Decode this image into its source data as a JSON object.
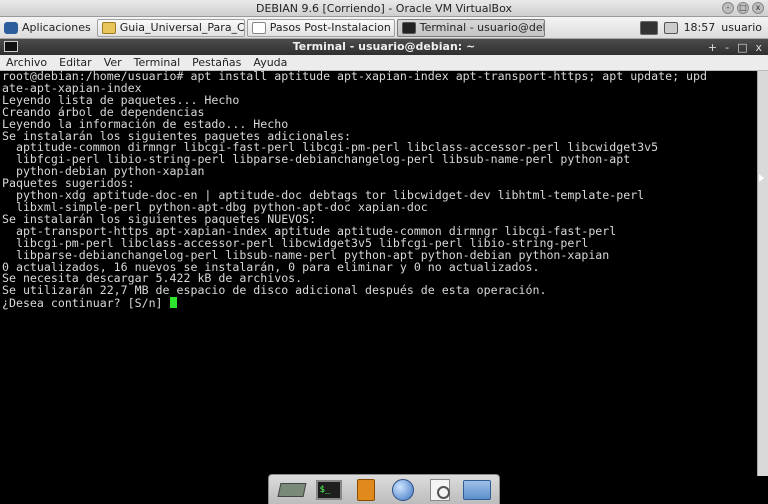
{
  "vbox": {
    "title": "DEBIAN 9.6 [Corriendo] - Oracle VM VirtualBox",
    "controls": [
      "-",
      "□",
      "x"
    ]
  },
  "panel": {
    "apps_label": "Aplicaciones",
    "tasks": [
      {
        "label": "Guia_Universal_Para_Co..."
      },
      {
        "label": "Pasos Post-Instalacion D..."
      },
      {
        "label": "Terminal - usuario@debi..."
      }
    ],
    "clock": "18:57",
    "user": "usuario"
  },
  "terminal": {
    "title": "Terminal - usuario@debian: ~",
    "controls": [
      "+",
      "-",
      "□",
      "x"
    ],
    "menu": [
      "Archivo",
      "Editar",
      "Ver",
      "Terminal",
      "Pestañas",
      "Ayuda"
    ],
    "lines": [
      "root@debian:/home/usuario# apt install aptitude apt-xapian-index apt-transport-https; apt update; upd",
      "ate-apt-xapian-index",
      "Leyendo lista de paquetes... Hecho",
      "Creando árbol de dependencias",
      "Leyendo la información de estado... Hecho",
      "Se instalarán los siguientes paquetes adicionales:",
      "  aptitude-common dirmngr libcgi-fast-perl libcgi-pm-perl libclass-accessor-perl libcwidget3v5",
      "  libfcgi-perl libio-string-perl libparse-debianchangelog-perl libsub-name-perl python-apt",
      "  python-debian python-xapian",
      "Paquetes sugeridos:",
      "  python-xdg aptitude-doc-en | aptitude-doc debtags tor libcwidget-dev libhtml-template-perl",
      "  libxml-simple-perl python-apt-dbg python-apt-doc xapian-doc",
      "Se instalarán los siguientes paquetes NUEVOS:",
      "  apt-transport-https apt-xapian-index aptitude aptitude-common dirmngr libcgi-fast-perl",
      "  libcgi-pm-perl libclass-accessor-perl libcwidget3v5 libfcgi-perl libio-string-perl",
      "  libparse-debianchangelog-perl libsub-name-perl python-apt python-debian python-xapian",
      "0 actualizados, 16 nuevos se instalarán, 0 para eliminar y 0 no actualizados.",
      "Se necesita descargar 5.422 kB de archivos.",
      "Se utilizarán 22,7 MB de espacio de disco adicional después de esta operación."
    ],
    "prompt": "¿Desea continuar? [S/n] "
  },
  "dock": {
    "items": [
      "show-desktop",
      "terminal",
      "file-manager",
      "web-browser",
      "app-finder",
      "folder"
    ]
  }
}
